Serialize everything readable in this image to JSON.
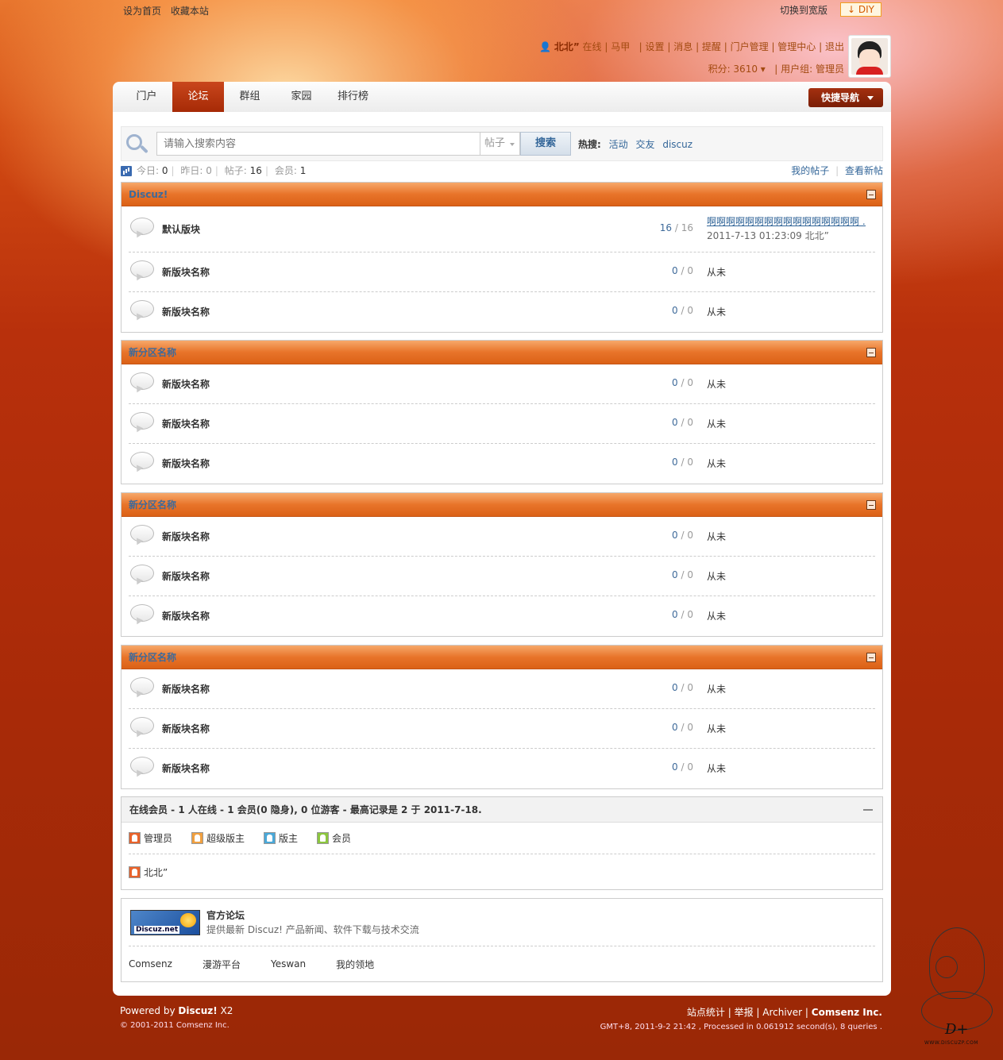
{
  "topbar": {
    "set_home": "设为首页",
    "bookmark": "收藏本站",
    "switch_wide": "切换到宽版",
    "diy": "DIY"
  },
  "user": {
    "name": "北北”",
    "status": "在线",
    "vest": "马甲",
    "links": [
      "设置",
      "消息",
      "提醒",
      "门户管理",
      "管理中心",
      "退出"
    ],
    "credits_label": "积分: 3610",
    "group_label": "用户组: 管理员"
  },
  "nav": {
    "items": [
      "门户",
      "论坛",
      "群组",
      "家园",
      "排行榜"
    ],
    "active_index": 1,
    "quick_nav": "快捷导航"
  },
  "search": {
    "placeholder": "请输入搜索内容",
    "type": "帖子",
    "button": "搜索",
    "hot_label": "热搜:",
    "hot_terms": [
      "活动",
      "交友",
      "discuz"
    ]
  },
  "stats": {
    "today_label": "今日:",
    "today": "0",
    "yesterday_label": "昨日:",
    "yesterday": "0",
    "posts_label": "帖子:",
    "posts": "16",
    "members_label": "会员:",
    "members": "1",
    "my_posts": "我的帖子",
    "new_posts": "查看新帖"
  },
  "categories": [
    {
      "title": "Discuz!",
      "forums": [
        {
          "name": "默认版块",
          "threads": "16",
          "posts": "16",
          "last_title": "啊啊啊啊啊啊啊啊啊啊啊啊啊啊啊啊 ...",
          "last_meta": "2011-7-13 01:23:09 北北”"
        },
        {
          "name": "新版块名称",
          "threads": "0",
          "posts": "0",
          "last": "从未"
        },
        {
          "name": "新版块名称",
          "threads": "0",
          "posts": "0",
          "last": "从未"
        }
      ]
    },
    {
      "title": "新分区名称",
      "forums": [
        {
          "name": "新版块名称",
          "threads": "0",
          "posts": "0",
          "last": "从未"
        },
        {
          "name": "新版块名称",
          "threads": "0",
          "posts": "0",
          "last": "从未"
        },
        {
          "name": "新版块名称",
          "threads": "0",
          "posts": "0",
          "last": "从未"
        }
      ]
    },
    {
      "title": "新分区名称",
      "forums": [
        {
          "name": "新版块名称",
          "threads": "0",
          "posts": "0",
          "last": "从未"
        },
        {
          "name": "新版块名称",
          "threads": "0",
          "posts": "0",
          "last": "从未"
        },
        {
          "name": "新版块名称",
          "threads": "0",
          "posts": "0",
          "last": "从未"
        }
      ]
    },
    {
      "title": "新分区名称",
      "forums": [
        {
          "name": "新版块名称",
          "threads": "0",
          "posts": "0",
          "last": "从未"
        },
        {
          "name": "新版块名称",
          "threads": "0",
          "posts": "0",
          "last": "从未"
        },
        {
          "name": "新版块名称",
          "threads": "0",
          "posts": "0",
          "last": "从未"
        }
      ]
    }
  ],
  "online": {
    "title": "在线会员 - 1 人在线 - 1 会员(0 隐身), 0 位游客 - 最高记录是 2 于 2011-7-18.",
    "legend": [
      {
        "label": "管理员",
        "color": "#e8632c"
      },
      {
        "label": "超级版主",
        "color": "#f0a040"
      },
      {
        "label": "版主",
        "color": "#4aa8d8"
      },
      {
        "label": "会员",
        "color": "#8cc63f"
      }
    ],
    "members": [
      "北北”"
    ]
  },
  "friendlinks": {
    "logo_text": "Discuz.net",
    "title": "官方论坛",
    "desc": "提供最新 Discuz! 产品新闻、软件下载与技术交流",
    "links": [
      "Comsenz",
      "漫游平台",
      "Yeswan",
      "我的领地"
    ]
  },
  "footer": {
    "powered_prefix": "Powered by",
    "powered_brand": "Discuz!",
    "powered_version": "X2",
    "copyright": "© 2001-2011 Comsenz Inc.",
    "links": [
      "站点统计",
      "举报",
      "Archiver"
    ],
    "company": "Comsenz Inc.",
    "debug": "GMT+8, 2011-9-2 21:42 , Processed in 0.061912 second(s), 8 queries ."
  },
  "watermark": {
    "text": "D+",
    "url": "WWW.DISCUZP.COM"
  },
  "colors": {
    "header_orange": "#e8742a",
    "link_blue": "#336699",
    "nav_active": "#b8360e",
    "background_red": "#a82a08"
  }
}
